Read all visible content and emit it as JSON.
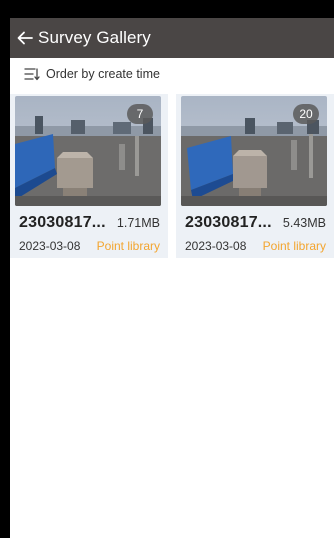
{
  "header": {
    "title": "Survey Gallery",
    "back_icon": "back-arrow-icon"
  },
  "sort": {
    "icon": "sort-list-icon",
    "label": "Order by create time"
  },
  "colors": {
    "titlebar": "#4a4645",
    "card_bg": "#edf1f6",
    "accent": "#f3a52f"
  },
  "items": [
    {
      "name": "23030817...",
      "size": "1.71MB",
      "date": "2023-03-08",
      "type": "Point library",
      "count": "7"
    },
    {
      "name": "23030817...",
      "size": "5.43MB",
      "date": "2023-03-08",
      "type": "Point library",
      "count": "20"
    }
  ]
}
